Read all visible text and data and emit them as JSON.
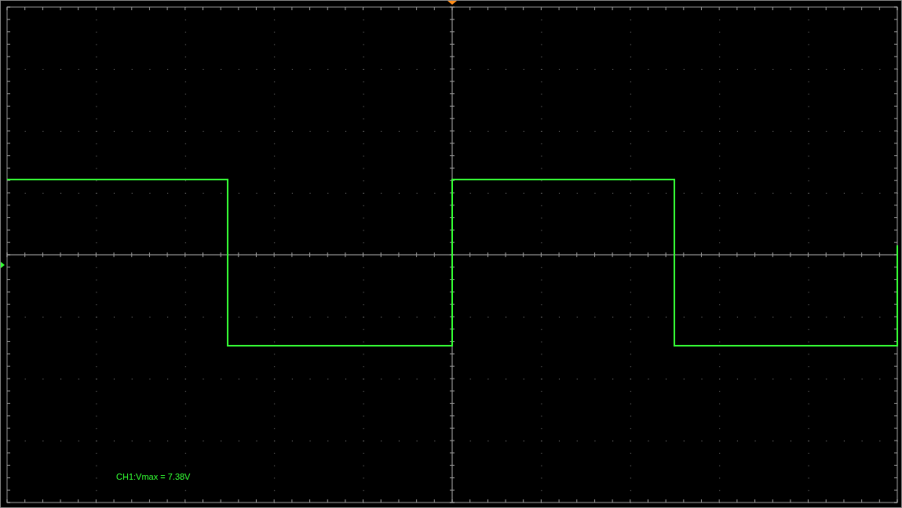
{
  "measurement": {
    "text": "CH1:Vmax = 7.38V"
  }
}
